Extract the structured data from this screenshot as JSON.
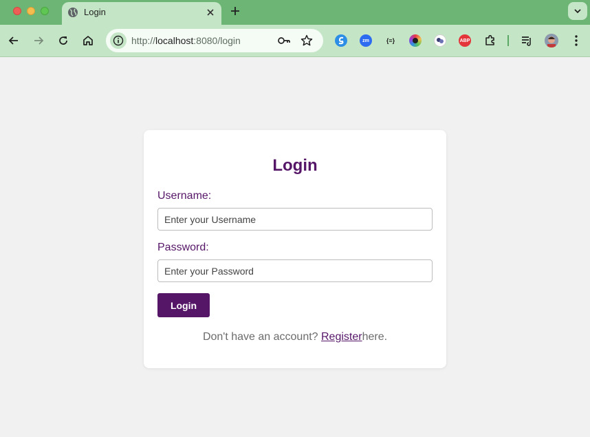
{
  "browser": {
    "tab_title": "Login",
    "url_scheme": "http://",
    "url_host": "localhost",
    "url_path": ":8080/login",
    "theme_color": "#6db575",
    "toolbar_color": "#c5e6c6",
    "extensions": [
      {
        "name": "shortcut-extension-icon",
        "color": "#2d8ee6",
        "label": ""
      },
      {
        "name": "zoom-extension-icon",
        "color": "#2d6cf0",
        "label": "zm"
      },
      {
        "name": "json-formatter-icon",
        "color": "#c5e6c6",
        "label": "{≡}"
      },
      {
        "name": "color-picker-extension-icon",
        "color": "#9b3dd8",
        "label": ""
      },
      {
        "name": "chatgpt-extension-icon",
        "color": "#ffffff",
        "label": ""
      },
      {
        "name": "adblock-plus-icon",
        "color": "#e3353a",
        "label": "ABP"
      }
    ]
  },
  "login_form": {
    "heading": "Login",
    "username_label": "Username:",
    "username_placeholder": "Enter your Username",
    "username_value": "",
    "password_label": "Password:",
    "password_placeholder": "Enter your Password",
    "password_value": "",
    "submit_label": "Login",
    "footer_prefix": "Don't have an account? ",
    "register_link": "Register",
    "footer_suffix": "here.",
    "accent_color": "#561668"
  }
}
